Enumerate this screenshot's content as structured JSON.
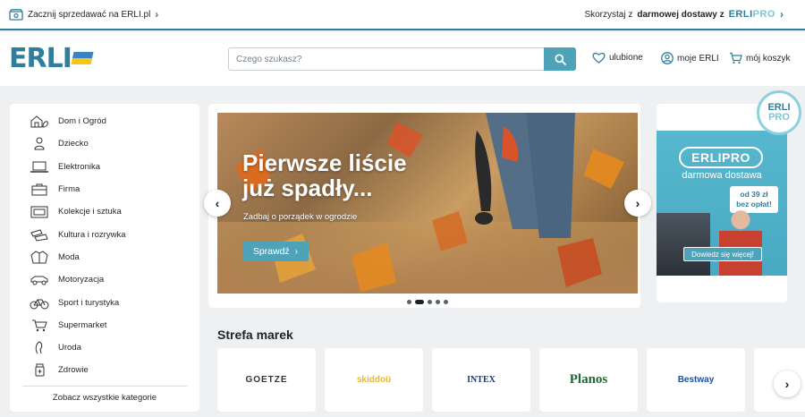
{
  "topbar": {
    "sell_text": "Zacznij sprzedawać na ERLI.pl",
    "delivery_prefix": "Skorzystaj z",
    "delivery_bold": "darmowej dostawy z",
    "pro_label_a": "ERLI",
    "pro_label_b": "PRO"
  },
  "header": {
    "logo_text": "ERLI",
    "search_placeholder": "Czego szukasz?",
    "favorites_label": "ulubione",
    "account_label": "moje ERLI",
    "cart_label": "mój koszyk"
  },
  "sidebar": {
    "categories": [
      {
        "label": "Dom i Ogród",
        "icon": "home-garden-icon"
      },
      {
        "label": "Dziecko",
        "icon": "child-icon"
      },
      {
        "label": "Elektronika",
        "icon": "laptop-icon"
      },
      {
        "label": "Firma",
        "icon": "briefcase-icon"
      },
      {
        "label": "Kolekcje i sztuka",
        "icon": "frame-icon"
      },
      {
        "label": "Kultura i rozrywka",
        "icon": "ticket-icon"
      },
      {
        "label": "Moda",
        "icon": "jacket-icon"
      },
      {
        "label": "Motoryzacja",
        "icon": "car-icon"
      },
      {
        "label": "Sport i turystyka",
        "icon": "bicycle-icon"
      },
      {
        "label": "Supermarket",
        "icon": "cart-icon"
      },
      {
        "label": "Uroda",
        "icon": "beauty-icon"
      },
      {
        "label": "Zdrowie",
        "icon": "health-icon"
      }
    ],
    "see_all": "Zobacz wszystkie kategorie"
  },
  "banner": {
    "title_line1": "Pierwsze liście",
    "title_line2": "już spadły...",
    "subtitle": "Zadbaj o porządek w ogrodzie",
    "cta_label": "Sprawdź",
    "slides": 5,
    "active_slide": 2
  },
  "promo": {
    "brand_a": "ERLI",
    "brand_b": "PRO",
    "headline": "darmowa dostawa",
    "price_line1": "od 39 zł",
    "price_line2": "bez opłat!",
    "cta_label": "Dowiedz się więcej!",
    "badge_a": "ERLI",
    "badge_b": "PRO"
  },
  "brands": {
    "title": "Strefa marek",
    "items": [
      {
        "label": "GOETZE",
        "color": "#333333"
      },
      {
        "label": "skiddoü",
        "color": "#e8b931"
      },
      {
        "label": "INTEX",
        "color": "#1d3b6f"
      },
      {
        "label": "Planos",
        "color": "#1a6b2f"
      },
      {
        "label": "Bestway",
        "color": "#1f4fa0"
      }
    ]
  },
  "colors": {
    "accent": "#2e7f9e",
    "button": "#4fa3b8",
    "background": "#eef0f2"
  }
}
